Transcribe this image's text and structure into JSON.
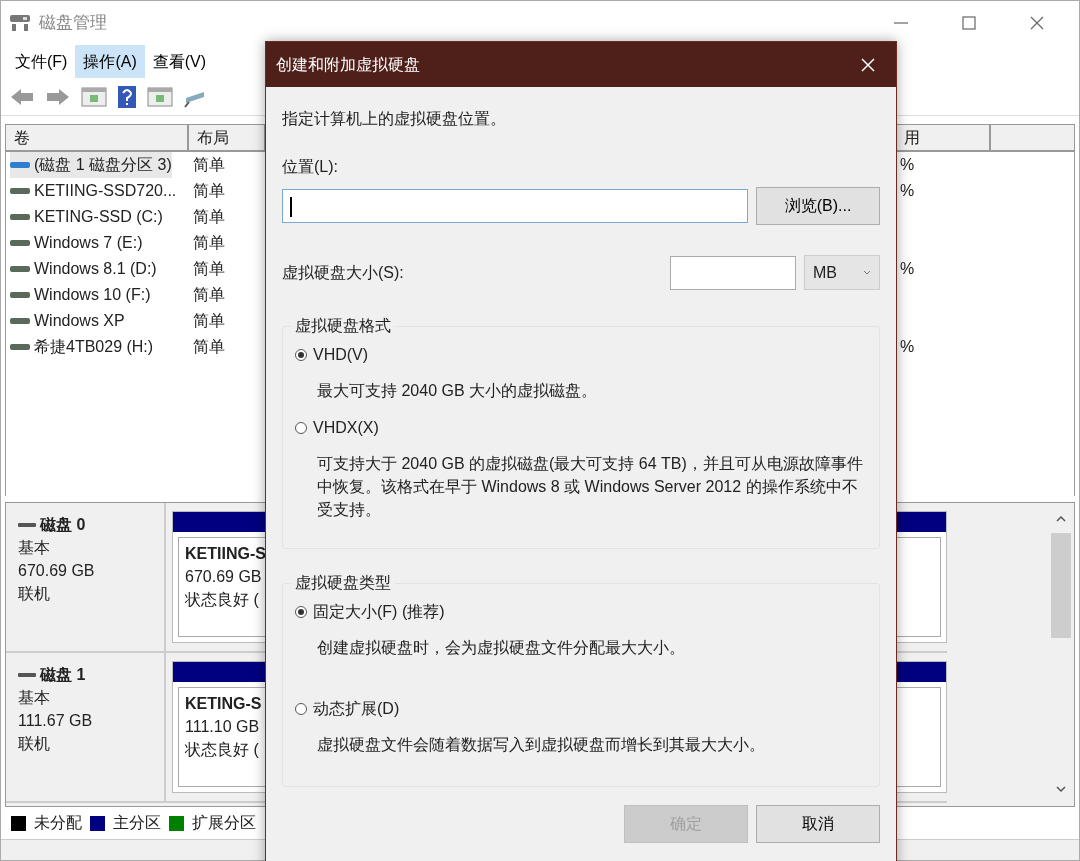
{
  "window": {
    "title": "磁盘管理"
  },
  "menu": [
    {
      "label": "文件(F)",
      "selected": false
    },
    {
      "label": "操作(A)",
      "selected": true
    },
    {
      "label": "查看(V)",
      "selected": false
    }
  ],
  "volumes": {
    "columns": [
      "卷",
      "布局",
      "用"
    ],
    "rows": [
      {
        "volume": "(磁盘 1 磁盘分区 3)",
        "layout": "简单",
        "free": "%",
        "selected": true
      },
      {
        "volume": "KETIING-SSD720...",
        "layout": "简单",
        "free": "%",
        "selected": false
      },
      {
        "volume": "KETING-SSD (C:)",
        "layout": "简单",
        "selected": false
      },
      {
        "volume": "Windows 7 (E:)",
        "layout": "简单",
        "selected": false
      },
      {
        "volume": "Windows 8.1 (D:)",
        "layout": "简单",
        "free": "%",
        "selected": false
      },
      {
        "volume": "Windows 10 (F:)",
        "layout": "简单",
        "selected": false
      },
      {
        "volume": "Windows XP",
        "layout": "简单",
        "selected": false
      },
      {
        "volume": "希捷4TB029 (H:)",
        "layout": "简单",
        "free": "%",
        "selected": false
      }
    ]
  },
  "disks": [
    {
      "name": "磁盘 0",
      "type": "基本",
      "size": "670.69 GB",
      "status": "联机",
      "partition": {
        "name": "KETIING-S",
        "size": "670.69 GB",
        "status": "状态良好 ("
      }
    },
    {
      "name": "磁盘 1",
      "type": "基本",
      "size": "111.67 GB",
      "status": "联机",
      "partition": {
        "name": "KETING-S",
        "size": "111.10 GB",
        "status": "状态良好 ("
      }
    }
  ],
  "legend": [
    {
      "label": "未分配",
      "color": "#000000"
    },
    {
      "label": "主分区",
      "color": "#000080"
    },
    {
      "label": "扩展分区",
      "color": "#008000"
    }
  ],
  "dialog": {
    "title": "创建和附加虚拟硬盘",
    "instruction": "指定计算机上的虚拟硬盘位置。",
    "location_label": "位置(L):",
    "browse_button": "浏览(B)...",
    "size_label": "虚拟硬盘大小(S):",
    "unit": "MB",
    "groups": [
      {
        "title": "虚拟硬盘格式",
        "options": [
          {
            "label": "VHD(V)",
            "selected": true,
            "description": "最大可支持 2040 GB 大小的虚拟磁盘。"
          },
          {
            "label": "VHDX(X)",
            "selected": false,
            "description": "可支持大于 2040 GB 的虚拟磁盘(最大可支持 64 TB)，并且可从电源故障事件中恢复。该格式在早于 Windows 8 或 Windows Server 2012 的操作系统中不受支持。"
          }
        ]
      },
      {
        "title": "虚拟硬盘类型",
        "options": [
          {
            "label": "固定大小(F) (推荐)",
            "selected": true,
            "description": "创建虚拟硬盘时，会为虚拟硬盘文件分配最大大小。"
          },
          {
            "label": "动态扩展(D)",
            "selected": false,
            "description": "虚拟硬盘文件会随着数据写入到虚拟硬盘而增长到其最大大小。"
          }
        ]
      }
    ],
    "buttons": [
      {
        "label": "确定",
        "disabled": true
      },
      {
        "label": "取消",
        "disabled": false
      }
    ]
  }
}
